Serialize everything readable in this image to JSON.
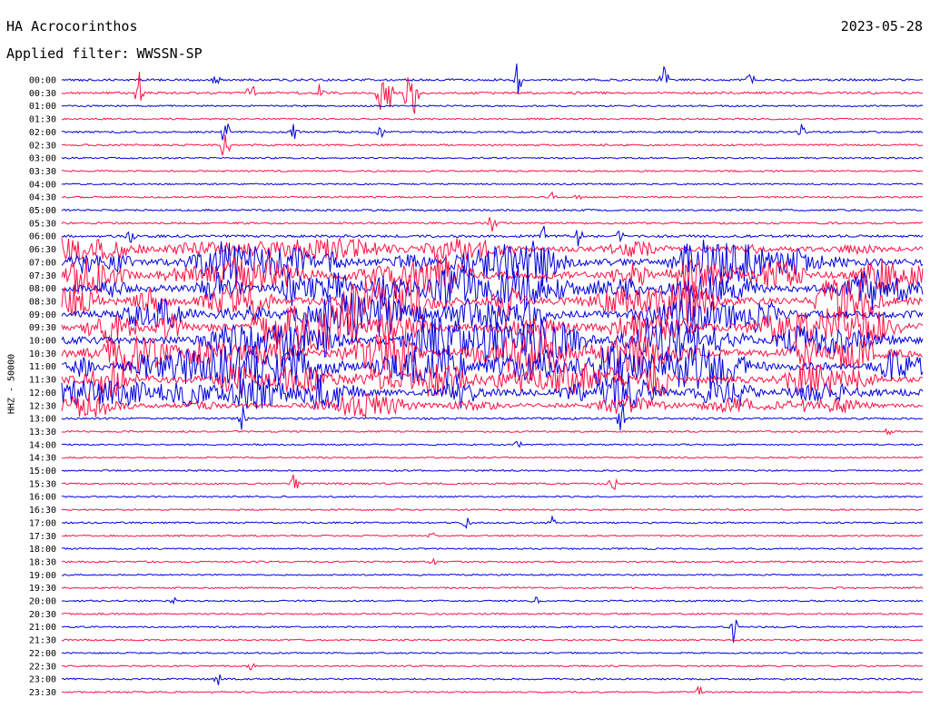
{
  "header": {
    "station": "HA Acrocorinthos",
    "date": "2023-05-28",
    "filter_label": "Applied filter:",
    "filter_value": "WWSSN-SP"
  },
  "chart_data": {
    "type": "line",
    "ylabel": "HHZ - 50000",
    "row_labels": [
      "00:00",
      "00:30",
      "01:00",
      "01:30",
      "02:00",
      "02:30",
      "03:00",
      "03:30",
      "04:00",
      "04:30",
      "05:00",
      "05:30",
      "06:00",
      "06:30",
      "07:00",
      "07:30",
      "08:00",
      "08:30",
      "09:00",
      "09:30",
      "10:00",
      "10:30",
      "11:00",
      "11:30",
      "12:00",
      "12:30",
      "13:00",
      "13:30",
      "14:00",
      "14:30",
      "15:00",
      "15:30",
      "16:00",
      "16:30",
      "17:00",
      "17:30",
      "18:00",
      "18:30",
      "19:00",
      "19:30",
      "20:00",
      "20:30",
      "21:00",
      "21:30",
      "22:00",
      "22:30",
      "23:00",
      "23:30"
    ],
    "row_minutes": 30,
    "colors": [
      "#0000dd",
      "#ff1144"
    ],
    "activity": [
      {
        "row": 0,
        "level": 0.15,
        "spikes": [
          [
            0.53,
            1.0
          ],
          [
            0.7,
            1.0
          ],
          [
            0.8,
            0.3
          ],
          [
            0.18,
            0.3
          ]
        ]
      },
      {
        "row": 1,
        "level": 0.15,
        "spikes": [
          [
            0.09,
            1.0
          ],
          [
            0.22,
            0.8
          ],
          [
            0.3,
            1.0
          ],
          [
            0.37,
            1.0
          ],
          [
            0.38,
            1.0
          ],
          [
            0.4,
            1.0
          ],
          [
            0.41,
            1.0
          ]
        ]
      },
      {
        "row": 2,
        "level": 0.05
      },
      {
        "row": 3,
        "level": 0.05
      },
      {
        "row": 4,
        "level": 0.1,
        "spikes": [
          [
            0.27,
            0.4
          ],
          [
            0.37,
            0.3
          ],
          [
            0.86,
            0.4
          ],
          [
            0.19,
            1.0
          ]
        ]
      },
      {
        "row": 5,
        "level": 0.08,
        "spikes": [
          [
            0.19,
            1.0
          ]
        ]
      },
      {
        "row": 6,
        "level": 0.05
      },
      {
        "row": 7,
        "level": 0.05
      },
      {
        "row": 8,
        "level": 0.04
      },
      {
        "row": 9,
        "level": 0.06,
        "spikes": [
          [
            0.57,
            0.2
          ],
          [
            0.6,
            0.2
          ]
        ]
      },
      {
        "row": 10,
        "level": 0.08
      },
      {
        "row": 11,
        "level": 0.1,
        "spikes": [
          [
            0.5,
            0.5
          ]
        ]
      },
      {
        "row": 12,
        "level": 0.2,
        "spikes": [
          [
            0.08,
            0.3
          ],
          [
            0.56,
            0.5
          ],
          [
            0.6,
            0.5
          ],
          [
            0.65,
            0.5
          ]
        ]
      },
      {
        "row": 13,
        "level": 0.55
      },
      {
        "row": 14,
        "level": 0.85
      },
      {
        "row": 15,
        "level": 0.9
      },
      {
        "row": 16,
        "level": 0.9
      },
      {
        "row": 17,
        "level": 0.95
      },
      {
        "row": 18,
        "level": 0.95
      },
      {
        "row": 19,
        "level": 0.95
      },
      {
        "row": 20,
        "level": 0.95
      },
      {
        "row": 21,
        "level": 0.95
      },
      {
        "row": 22,
        "level": 0.95
      },
      {
        "row": 23,
        "level": 0.9
      },
      {
        "row": 24,
        "level": 0.85
      },
      {
        "row": 25,
        "level": 0.45
      },
      {
        "row": 26,
        "level": 0.12,
        "spikes": [
          [
            0.21,
            0.6
          ],
          [
            0.65,
            1.0
          ]
        ]
      },
      {
        "row": 27,
        "level": 0.06,
        "spikes": [
          [
            0.96,
            0.2
          ]
        ]
      },
      {
        "row": 28,
        "level": 0.04,
        "spikes": [
          [
            0.53,
            0.2
          ]
        ]
      },
      {
        "row": 29,
        "level": 0.04
      },
      {
        "row": 30,
        "level": 0.04
      },
      {
        "row": 31,
        "level": 0.06,
        "spikes": [
          [
            0.27,
            0.6
          ],
          [
            0.64,
            0.4
          ]
        ]
      },
      {
        "row": 32,
        "level": 0.04
      },
      {
        "row": 33,
        "level": 0.05
      },
      {
        "row": 34,
        "level": 0.06,
        "spikes": [
          [
            0.47,
            0.3
          ],
          [
            0.57,
            0.3
          ]
        ]
      },
      {
        "row": 35,
        "level": 0.05,
        "spikes": [
          [
            0.43,
            0.2
          ]
        ]
      },
      {
        "row": 36,
        "level": 0.05
      },
      {
        "row": 37,
        "level": 0.05,
        "spikes": [
          [
            0.43,
            0.2
          ]
        ]
      },
      {
        "row": 38,
        "level": 0.03
      },
      {
        "row": 39,
        "level": 0.05
      },
      {
        "row": 40,
        "level": 0.05,
        "spikes": [
          [
            0.13,
            0.2
          ],
          [
            0.55,
            0.2
          ]
        ]
      },
      {
        "row": 41,
        "level": 0.05
      },
      {
        "row": 42,
        "level": 0.05,
        "spikes": [
          [
            0.78,
            1.0
          ]
        ]
      },
      {
        "row": 43,
        "level": 0.05
      },
      {
        "row": 44,
        "level": 0.04
      },
      {
        "row": 45,
        "level": 0.05,
        "spikes": [
          [
            0.22,
            0.2
          ]
        ]
      },
      {
        "row": 46,
        "level": 0.06,
        "spikes": [
          [
            0.18,
            0.5
          ]
        ]
      },
      {
        "row": 47,
        "level": 0.05,
        "spikes": [
          [
            0.74,
            0.4
          ]
        ]
      }
    ]
  }
}
